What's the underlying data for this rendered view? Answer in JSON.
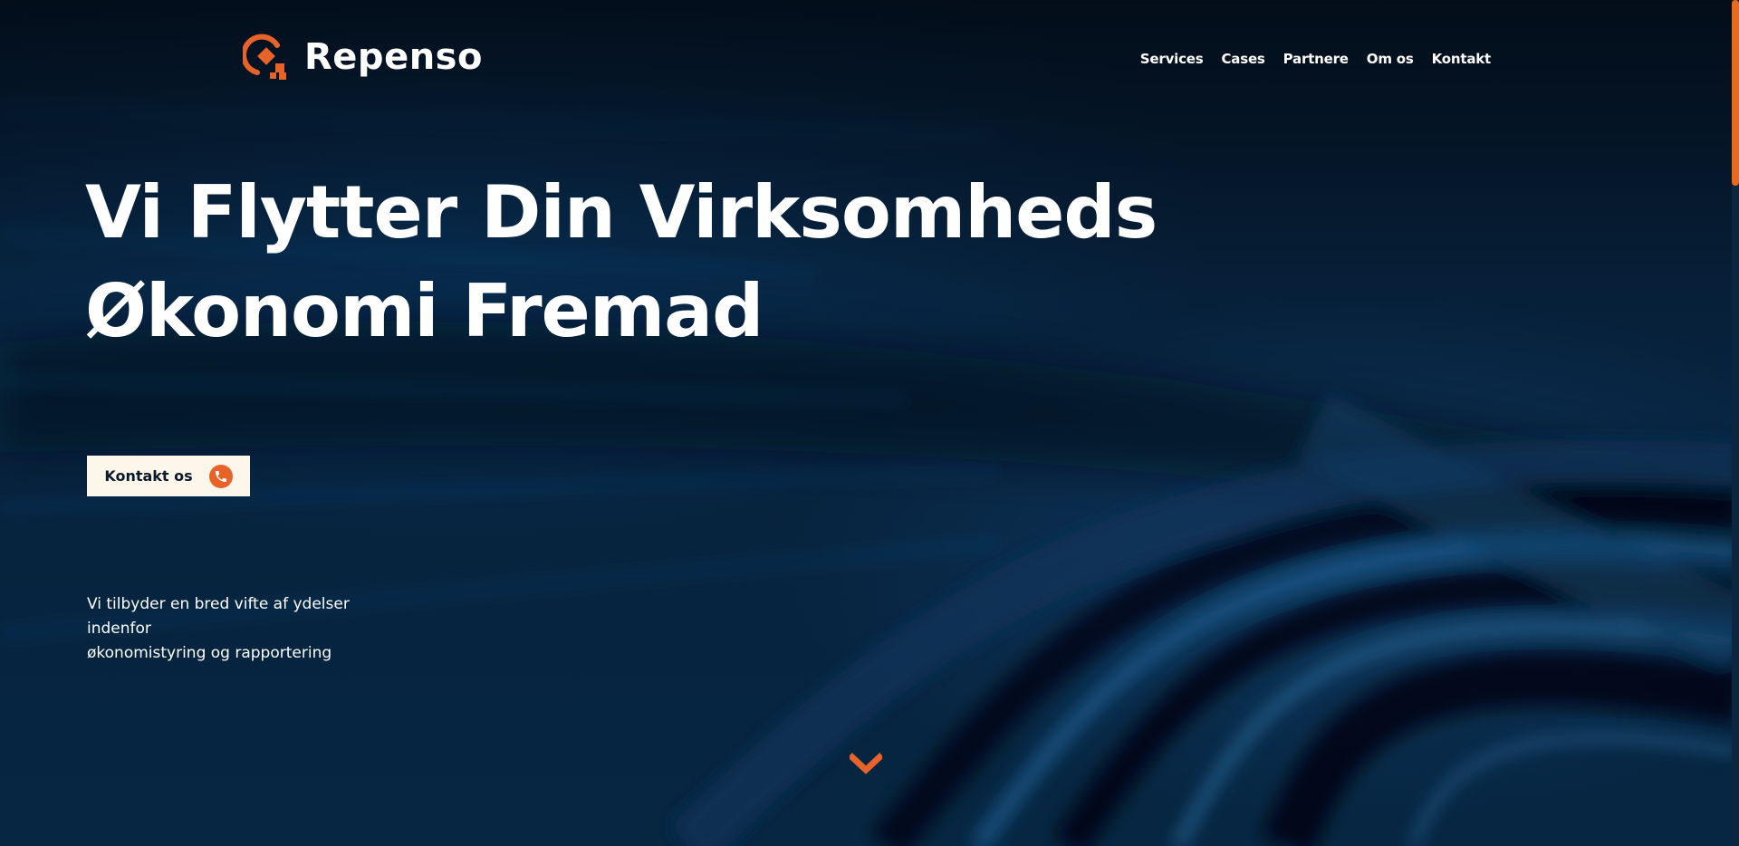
{
  "brand": {
    "name": "Repenso",
    "accent_color": "#e8632a",
    "logo_icon": "repenso-logo-icon"
  },
  "nav": {
    "items": [
      {
        "label": "Services"
      },
      {
        "label": "Cases"
      },
      {
        "label": "Partnere"
      },
      {
        "label": "Om os"
      },
      {
        "label": "Kontakt"
      }
    ]
  },
  "hero": {
    "headline_line1": "Vi Flytter Din Virksomheds",
    "headline_line2": "Økonomi Fremad",
    "cta_label": "Kontakt os",
    "cta_icon": "phone-icon",
    "subtitle_line1": "Vi tilbyder en bred vifte af ydelser indenfor",
    "subtitle_line2": "økonomistyring og rapportering",
    "scroll_icon": "chevron-down-icon",
    "background_color": "#061a2e"
  }
}
